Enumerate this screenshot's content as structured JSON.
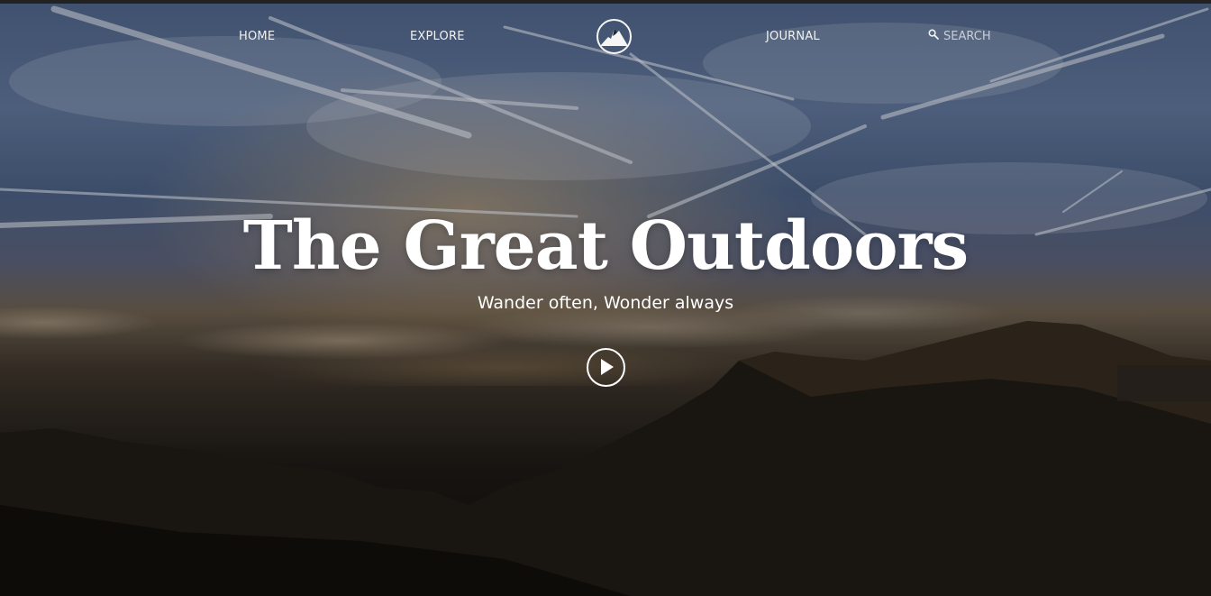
{
  "nav": {
    "home_label": "HOME",
    "explore_label": "EXPLORE",
    "journal_label": "JOURNAL",
    "search_placeholder": "SEARCH",
    "search_icon": "search-icon",
    "logo_icon": "mountain-logo-icon"
  },
  "hero": {
    "title": "The Great Outdoors",
    "subtitle": "Wander often, Wonder always",
    "play_icon": "play-icon"
  },
  "colors": {
    "text": "#ffffff",
    "sky": "#4e6488",
    "horizon": "#6c5f4f",
    "ground": "#0e0c0a"
  }
}
